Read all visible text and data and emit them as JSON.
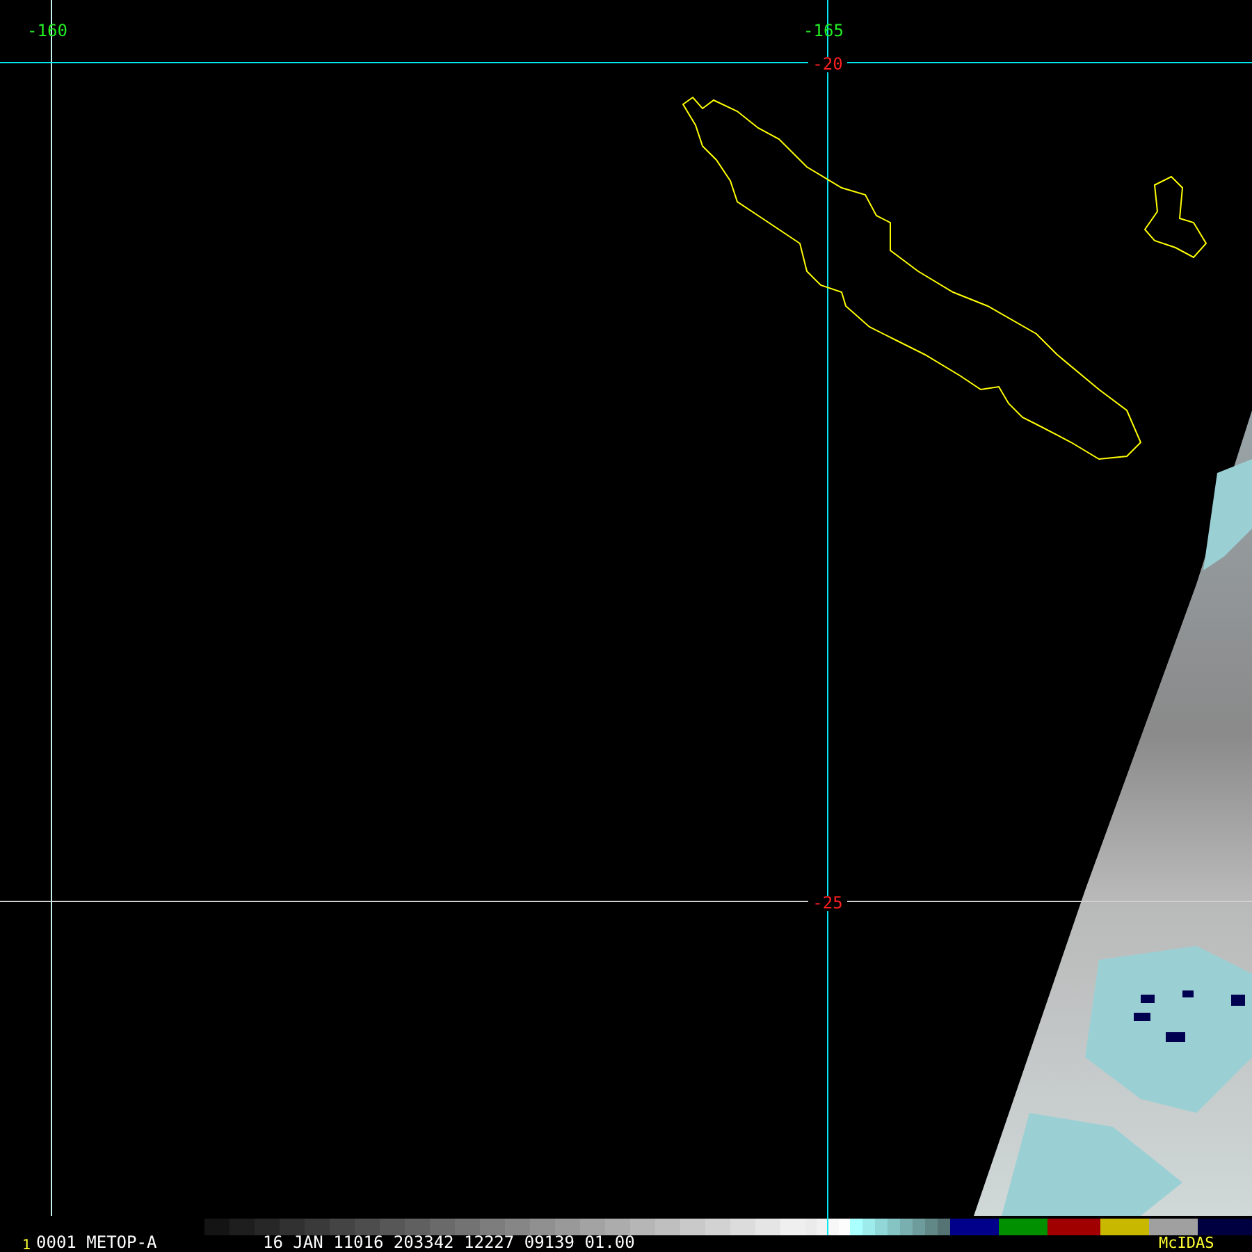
{
  "grid_labels": [
    {
      "kind": "longitude",
      "text": "-160"
    },
    {
      "kind": "longitude",
      "text": "-165"
    },
    {
      "kind": "latitude",
      "text": "-20"
    },
    {
      "kind": "latitude",
      "text": "-25"
    }
  ],
  "status_bar": {
    "frame_number": "1",
    "image_id": "0001 METOP-A",
    "image_info": "16 JAN 11016 203342 12227 09139 01.00",
    "software": "McIDAS"
  }
}
